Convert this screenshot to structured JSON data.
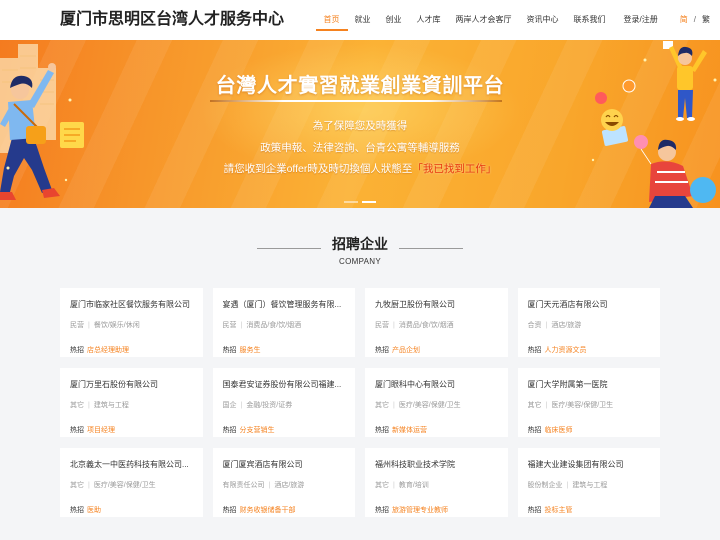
{
  "header": {
    "logo": "厦门市思明区台湾人才服务中心",
    "nav": [
      {
        "label": "首页",
        "active": true
      },
      {
        "label": "就业",
        "active": false
      },
      {
        "label": "创业",
        "active": false
      },
      {
        "label": "人才库",
        "active": false
      },
      {
        "label": "两岸人才会客厅",
        "active": false
      },
      {
        "label": "资讯中心",
        "active": false
      },
      {
        "label": "联系我们",
        "active": false
      },
      {
        "label": "登录/注册",
        "active": false
      }
    ],
    "lang": {
      "options": [
        {
          "label": "简",
          "active": true
        },
        {
          "label": "繁",
          "active": false
        }
      ],
      "separator": "/"
    }
  },
  "banner": {
    "title": "台灣人才實習就業創業資訓平台",
    "lines": [
      "為了保障您及時獲得",
      "政策申報、法律咨詢、台青公寓等輔導服務"
    ],
    "notice_prefix": "請您收到企業offer時及時切換個人狀態至",
    "notice_highlight": "「我已找到工作」",
    "carousel": {
      "count": 2,
      "active_index": 1
    }
  },
  "section": {
    "title": "招聘企业",
    "subtitle": "COMPANY",
    "hot_label": "热招",
    "tag_separator": "|"
  },
  "companies": [
    {
      "name": "厦门市临家社区餐饮服务有限公司",
      "ownership": "民营",
      "industry": "餐饮/娱乐/休闲",
      "hot_job": "店总经理助理"
    },
    {
      "name": "宴遇（厦门）餐饮管理服务有限...",
      "ownership": "民营",
      "industry": "消费品/食/饮/烟酒",
      "hot_job": "服务生"
    },
    {
      "name": "九牧厨卫股份有限公司",
      "ownership": "民营",
      "industry": "消费品/食/饮/烟酒",
      "hot_job": "产品企划"
    },
    {
      "name": "厦门天元酒店有限公司",
      "ownership": "合资",
      "industry": "酒店/旅游",
      "hot_job": "人力资源文员"
    },
    {
      "name": "厦门万里石股份有限公司",
      "ownership": "其它",
      "industry": "建筑与工程",
      "hot_job": "项目经理"
    },
    {
      "name": "国泰君安证券股份有限公司福建...",
      "ownership": "国企",
      "industry": "金融/投资/证券",
      "hot_job": "分支营销生"
    },
    {
      "name": "厦门眼科中心有限公司",
      "ownership": "其它",
      "industry": "医疗/美容/保健/卫生",
      "hot_job": "新媒体运营"
    },
    {
      "name": "厦门大学附属第一医院",
      "ownership": "其它",
      "industry": "医疗/美容/保健/卫生",
      "hot_job": "临床医师"
    },
    {
      "name": "北京義太一中医药科技有限公司...",
      "ownership": "其它",
      "industry": "医疗/美容/保健/卫生",
      "hot_job": "医助"
    },
    {
      "name": "厦门厦宾酒店有限公司",
      "ownership": "有限责任公司",
      "industry": "酒店/旅游",
      "hot_job": "财务收银储备干部"
    },
    {
      "name": "福州科技职业技术学院",
      "ownership": "其它",
      "industry": "教育/培训",
      "hot_job": "旅游管理专业教师"
    },
    {
      "name": "福建大业建设集团有限公司",
      "ownership": "股份制企业",
      "industry": "建筑与工程",
      "hot_job": "投标主管"
    }
  ],
  "colors": {
    "accent": "#f5821f",
    "highlight": "#e8380d",
    "text": "#333333",
    "muted": "#999999",
    "section_bg": "#f4f5f7"
  }
}
